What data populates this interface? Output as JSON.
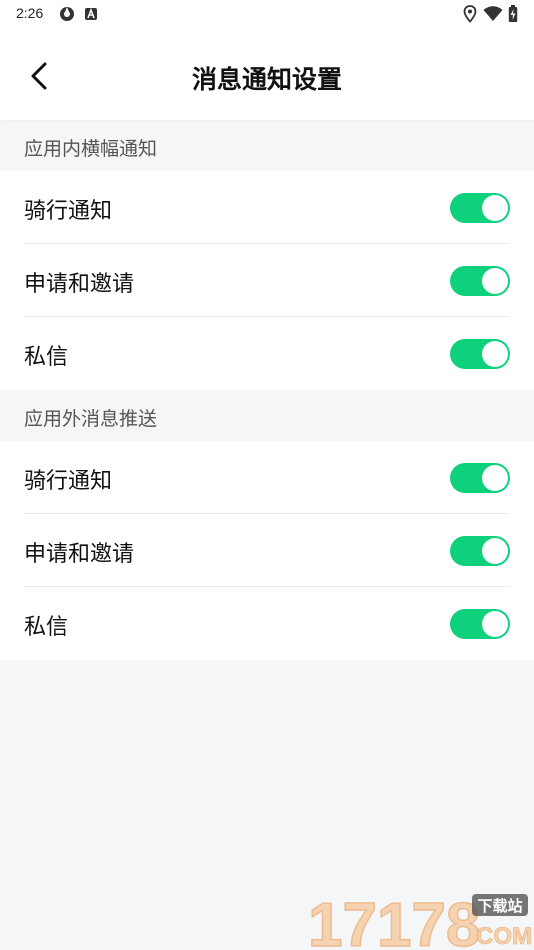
{
  "status_bar": {
    "time": "2:26"
  },
  "header": {
    "title": "消息通知设置"
  },
  "sections": [
    {
      "label": "应用内横幅通知",
      "items": [
        {
          "label": "骑行通知",
          "enabled": true
        },
        {
          "label": "申请和邀请",
          "enabled": true
        },
        {
          "label": "私信",
          "enabled": true
        }
      ]
    },
    {
      "label": "应用外消息推送",
      "items": [
        {
          "label": "骑行通知",
          "enabled": true
        },
        {
          "label": "申请和邀请",
          "enabled": true
        },
        {
          "label": "私信",
          "enabled": true
        }
      ]
    }
  ],
  "colors": {
    "toggle_on": "#10d17b",
    "background": "#f5f6f8"
  },
  "watermark": {
    "number": "17178",
    "badge": "下载站",
    "domain": "COM"
  }
}
